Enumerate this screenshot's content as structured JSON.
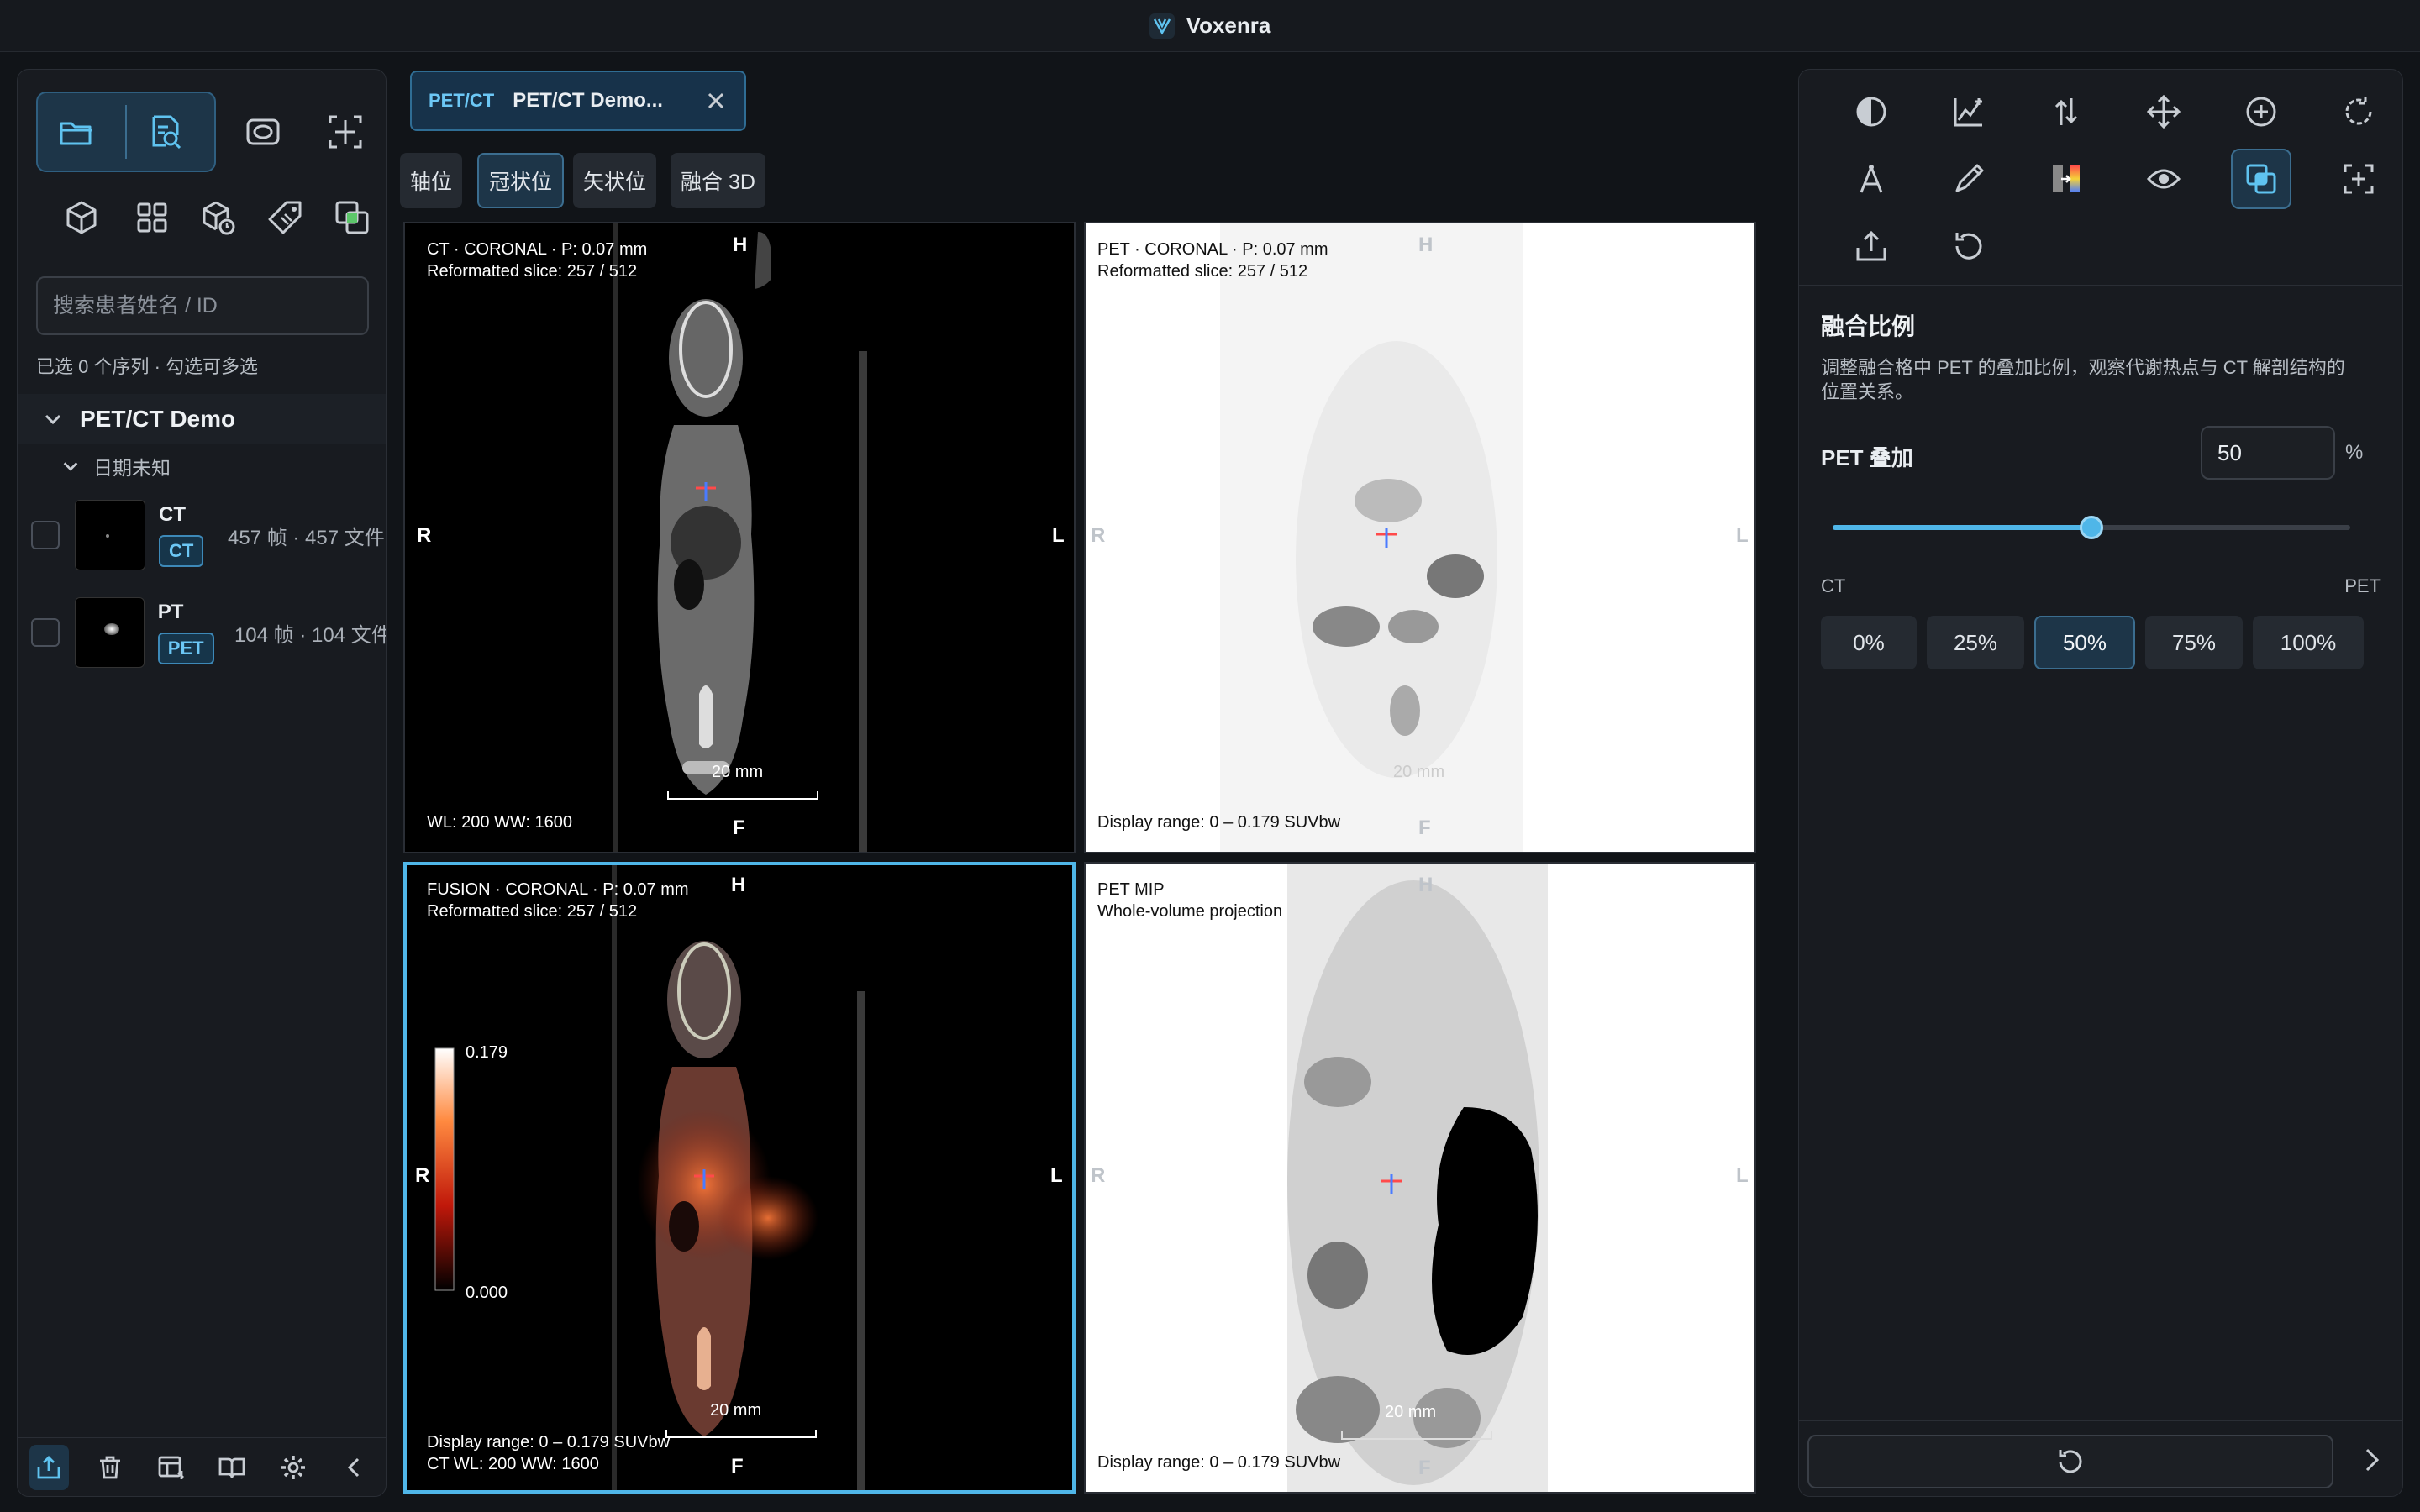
{
  "app": {
    "title": "Voxenra"
  },
  "left": {
    "search_placeholder": "搜索患者姓名 / ID",
    "selection_info": "已选 0 个序列 · 勾选可多选",
    "study": {
      "title": "PET/CT Demo",
      "date_label": "日期未知"
    },
    "series": [
      {
        "name": "CT",
        "badge": "CT",
        "count": "457 帧 · 457 文件"
      },
      {
        "name": "PT",
        "badge": "PET",
        "count": "104 帧 · 104 文件"
      }
    ],
    "toolbar_icons": [
      "folder-open-icon",
      "study-search-icon",
      "contour-icon",
      "crop-icon",
      "cube-icon",
      "grid-icon",
      "volume-clock-icon",
      "tag-icon",
      "overlay-icon"
    ],
    "bottom_icons": [
      "export-icon",
      "trash-icon",
      "layout-icon",
      "book-icon",
      "gear-icon",
      "collapse-left-icon"
    ]
  },
  "center": {
    "tab": {
      "tag": "PET/CT",
      "title": "PET/CT Demo..."
    },
    "view_buttons": [
      "轴位",
      "冠状位",
      "矢状位",
      "融合 3D"
    ],
    "active_view": "冠状位",
    "viewports": {
      "ct": {
        "line1": "CT · CORONAL · P: 0.07 mm",
        "line2": "Reformatted slice: 257 / 512",
        "footer": "WL: 200   WW: 1600",
        "scale": "20 mm"
      },
      "pet": {
        "line1": "PET · CORONAL · P: 0.07 mm",
        "line2": "Reformatted slice: 257 / 512",
        "footer": "Display range: 0 – 0.179 SUVbw",
        "scale": "20 mm"
      },
      "fusion": {
        "line1": "FUSION · CORONAL · P: 0.07 mm",
        "line2": "Reformatted slice: 257 / 512",
        "footer1": "Display range: 0 – 0.179 SUVbw",
        "footer2": "CT WL: 200  WW: 1600",
        "scale": "20 mm",
        "colorbar_max": "0.179",
        "colorbar_min": "0.000"
      },
      "mip": {
        "line1": "PET MIP",
        "line2": "Whole-volume projection",
        "footer": "Display range: 0 – 0.179 SUVbw",
        "scale": "20 mm"
      }
    },
    "orientation": {
      "top": "H",
      "bottom": "F",
      "left": "R",
      "right": "L"
    }
  },
  "right": {
    "tool_icons": [
      "contrast-icon",
      "histogram-icon",
      "flip-icon",
      "pan-icon",
      "zoom-icon",
      "rotate-icon",
      "measure-icon",
      "pencil-icon",
      "colormap-icon",
      "eye-icon",
      "fusion-icon",
      "fit-icon",
      "export-icon",
      "reset-icon"
    ],
    "active_tool": "fusion-icon",
    "panel_title": "融合比例",
    "description": "调整融合格中 PET 的叠加比例，观察代谢热点与 CT 解剖结构的位置关系。",
    "overlay_label": "PET 叠加",
    "overlay_value": "50",
    "unit": "%",
    "slider_fraction": 0.5,
    "range_left": "CT",
    "range_right": "PET",
    "presets": [
      "0%",
      "25%",
      "50%",
      "75%",
      "100%"
    ],
    "active_preset": "50%"
  },
  "colors": {
    "accent": "#4fb6e8",
    "panel": "#181b20",
    "active_bg": "#1d3548"
  }
}
